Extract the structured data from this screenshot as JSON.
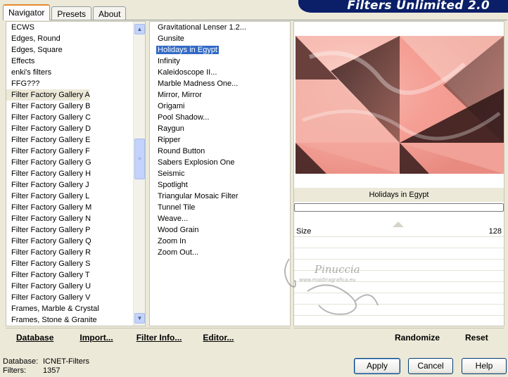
{
  "window": {
    "title": "Filters Unlimited 2.0"
  },
  "tabs": [
    {
      "label": "Navigator",
      "active": true
    },
    {
      "label": "Presets",
      "active": false
    },
    {
      "label": "About",
      "active": false
    }
  ],
  "categories": {
    "items": [
      "ECWS",
      "Edges, Round",
      "Edges, Square",
      "Effects",
      "enki's filters",
      "FFG???",
      "Filter Factory Gallery A",
      "Filter Factory Gallery B",
      "Filter Factory Gallery C",
      "Filter Factory Gallery D",
      "Filter Factory Gallery E",
      "Filter Factory Gallery F",
      "Filter Factory Gallery G",
      "Filter Factory Gallery H",
      "Filter Factory Gallery J",
      "Filter Factory Gallery L",
      "Filter Factory Gallery M",
      "Filter Factory Gallery N",
      "Filter Factory Gallery P",
      "Filter Factory Gallery Q",
      "Filter Factory Gallery R",
      "Filter Factory Gallery S",
      "Filter Factory Gallery T",
      "Filter Factory Gallery U",
      "Filter Factory Gallery V",
      "Frames, Marble & Crystal",
      "Frames, Stone & Granite"
    ],
    "selected": "Filter Factory Gallery A"
  },
  "filters": {
    "items": [
      "Gravitational Lenser 1.2...",
      "Gunsite",
      "Holidays in Egypt",
      "Infinity",
      "Kaleidoscope II...",
      "Marble Madness One...",
      "Mirror, Mirror",
      "Origami",
      "Pool Shadow...",
      "Raygun",
      "Ripper",
      "Round Button",
      "Sabers Explosion One",
      "Seismic",
      "Spotlight",
      "Triangular Mosaic Filter",
      "Tunnel Tile",
      "Weave...",
      "Wood Grain",
      "Zoom In",
      "Zoom Out..."
    ],
    "selected": "Holidays in Egypt"
  },
  "preview": {
    "caption": "Holidays in Egypt"
  },
  "params": [
    {
      "label": "Size",
      "value": "128"
    }
  ],
  "watermark": {
    "name": "Pinuccia",
    "url": "www.maidiragrafica.eu"
  },
  "left_actions": [
    "Database",
    "Import...",
    "Filter Info...",
    "Editor..."
  ],
  "right_actions": [
    "Randomize",
    "Reset"
  ],
  "status": {
    "database_label": "Database:",
    "database_value": "ICNET-Filters",
    "filters_label": "Filters:",
    "filters_value": "1357"
  },
  "buttons": {
    "apply": "Apply",
    "cancel": "Cancel",
    "help": "Help"
  }
}
